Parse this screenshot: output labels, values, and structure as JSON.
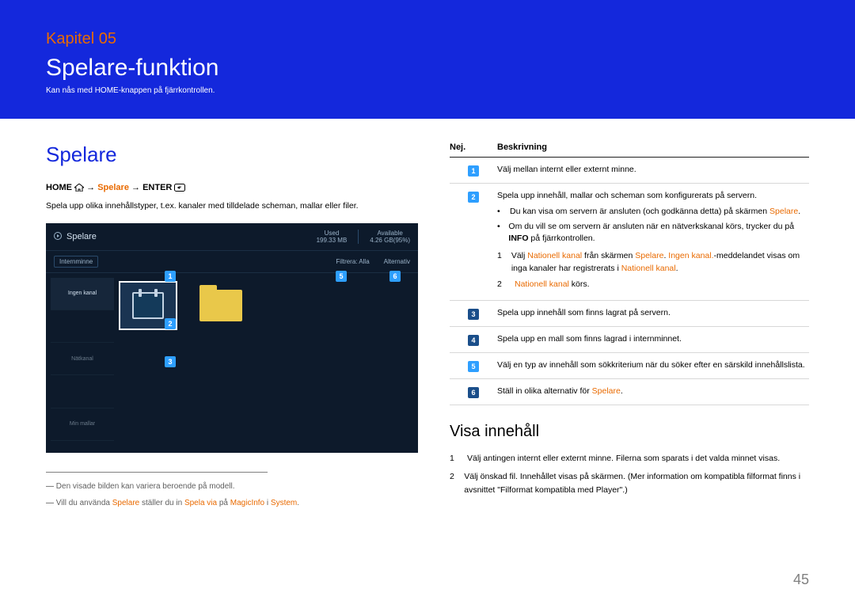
{
  "banner": {
    "chapter": "Kapitel 05",
    "title": "Spelare-funktion",
    "subtitle": "Kan nås med HOME-knappen på fjärrkontrollen."
  },
  "left": {
    "section_title": "Spelare",
    "breadcrumb": {
      "home": "HOME",
      "arrow": "→",
      "mid": "Spelare",
      "enter": "ENTER"
    },
    "lead": "Spela upp olika innehållstyper, t.ex. kanaler med tilldelade scheman, mallar eller filer.",
    "footnotes": [
      {
        "dash": "―",
        "text": "Den visade bilden kan variera beroende på modell."
      },
      {
        "dash": "―",
        "parts": [
          "Vill du använda ",
          "Spelare",
          " ställer du in ",
          "Spela via",
          " på ",
          "MagicInfo",
          " i ",
          "System",
          "."
        ]
      }
    ],
    "screenshot": {
      "title": "Spelare",
      "used_label": "Used",
      "used_val": "199.33 MB",
      "avail_label": "Available",
      "avail_val": "4.26 GB(95%)",
      "internminne": "Internminne",
      "filtrera": "Filtrera: Alla",
      "alternativ": "Alternativ",
      "side_items": [
        "Ingen kanal",
        "",
        "Nätkanal",
        "",
        "Min mallar"
      ],
      "badges": {
        "b1": "1",
        "b2": "2",
        "b3": "3",
        "b5": "5",
        "b6": "6"
      }
    }
  },
  "right": {
    "header": {
      "nej": "Nej.",
      "beskrivning": "Beskrivning"
    },
    "rows": [
      {
        "badge": "1",
        "html": "plain",
        "text": "Välj mellan internt eller externt minne."
      },
      {
        "badge": "2",
        "html": "complex"
      },
      {
        "badge": "3",
        "html": "plain",
        "text": "Spela upp innehåll som finns lagrat på servern."
      },
      {
        "badge": "4",
        "html": "plain",
        "text": "Spela upp en mall som finns lagrad i internminnet."
      },
      {
        "badge": "5",
        "html": "plain",
        "text": "Välj en typ av innehåll som sökkriterium när du söker efter en särskild innehållslista."
      },
      {
        "badge": "6",
        "html": "accent",
        "pre": "Ställ in olika alternativ för ",
        "accent": "Spelare",
        "post": "."
      }
    ],
    "row2": {
      "lead": "Spela upp innehåll, mallar och scheman som konfigurerats på servern.",
      "bullet1_pre": "Du kan visa om servern är ansluten (och godkänna detta) på skärmen ",
      "bullet1_accent": "Spelare",
      "bullet1_post": ".",
      "bullet2_pre": "Om du vill se om servern är ansluten när en nätverkskanal körs, trycker du på ",
      "bullet2_bold": "INFO",
      "bullet2_post": " på fjärrkontrollen.",
      "step1_pre": "Välj ",
      "step1_a1": "Nationell kanal",
      "step1_mid1": " från skärmen ",
      "step1_a2": "Spelare",
      "step1_mid2": ". ",
      "step1_a3": "Ingen kanal.",
      "step1_mid3": "-meddelandet visas om inga kanaler har registrerats i ",
      "step1_a4": "Nationell kanal",
      "step1_post": ".",
      "step2_a": "Nationell kanal",
      "step2_post": " körs."
    },
    "subheading": "Visa innehåll",
    "numlist": [
      {
        "n": "1",
        "text": "Välj antingen internt eller externt minne. Filerna som sparats i det valda minnet visas."
      },
      {
        "n": "2",
        "text": "Välj önskad fil. Innehållet visas på skärmen. (Mer information om kompatibla filformat finns i avsnittet \"Filformat kompatibla med Player\".)"
      }
    ]
  },
  "page_number": "45"
}
